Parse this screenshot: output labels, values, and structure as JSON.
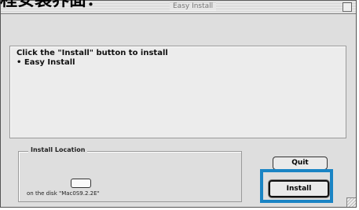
{
  "caption": "程安装界面：",
  "window": {
    "title": "Easy Install"
  },
  "instructions": {
    "line1": "Click the \"Install\" button to install",
    "line2": "• Easy Install"
  },
  "install_location": {
    "legend": "Install Location",
    "disk_text": "on the disk \"Mac0S9.2.2E\""
  },
  "buttons": {
    "quit": "Quit",
    "install": "Install"
  },
  "colors": {
    "highlight": "#1a84c4"
  }
}
